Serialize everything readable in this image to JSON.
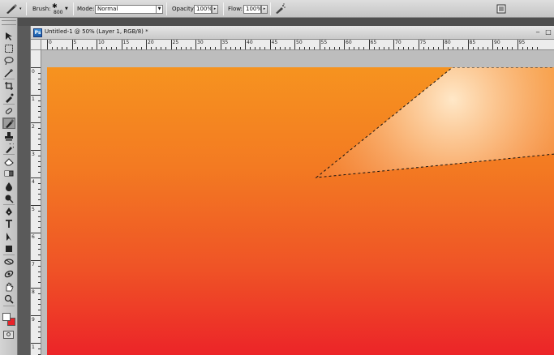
{
  "options_bar": {
    "brush_label": "Brush:",
    "brush_size": "800",
    "mode_label": "Mode:",
    "mode_value": "Normal",
    "opacity_label": "Opacity:",
    "opacity_value": "100%",
    "flow_label": "Flow:",
    "flow_value": "100%",
    "icons": [
      "brush-tool-icon",
      "airbrush-icon",
      "palette-toggle-icon"
    ]
  },
  "document": {
    "title": "Untitled-1 @ 50% (Layer 1, RGB/8) *",
    "icon_letter": "Ps",
    "minimize_label": "‒",
    "restore_label": "□"
  },
  "ruler": {
    "h_labels": [
      "0",
      "5",
      "10",
      "15",
      "20",
      "25",
      "30",
      "35",
      "40",
      "45",
      "50",
      "55",
      "60",
      "65",
      "70",
      "75",
      "80",
      "85",
      "90",
      "95"
    ],
    "v_labels": [
      "0",
      "1",
      "2",
      "3",
      "4",
      "5",
      "6",
      "7",
      "8",
      "9",
      "1"
    ]
  },
  "tools": {
    "items": [
      "move-tool",
      "marquee-tool",
      "lasso-tool",
      "magic-wand-tool",
      "crop-tool",
      "eyedropper-tool",
      "healing-brush-tool",
      "brush-tool",
      "clone-stamp-tool",
      "history-brush-tool",
      "eraser-tool",
      "gradient-tool",
      "blur-tool",
      "dodge-tool",
      "pen-tool",
      "type-tool",
      "path-selection-tool",
      "shape-tool",
      "3d-rotate-tool",
      "3d-orbit-tool",
      "hand-tool",
      "zoom-tool"
    ],
    "active": "brush-tool"
  },
  "colors": {
    "foreground": "#ffffff",
    "background": "#e8232a",
    "gradient_top": "#f6931f",
    "gradient_bottom": "#ec2428"
  }
}
